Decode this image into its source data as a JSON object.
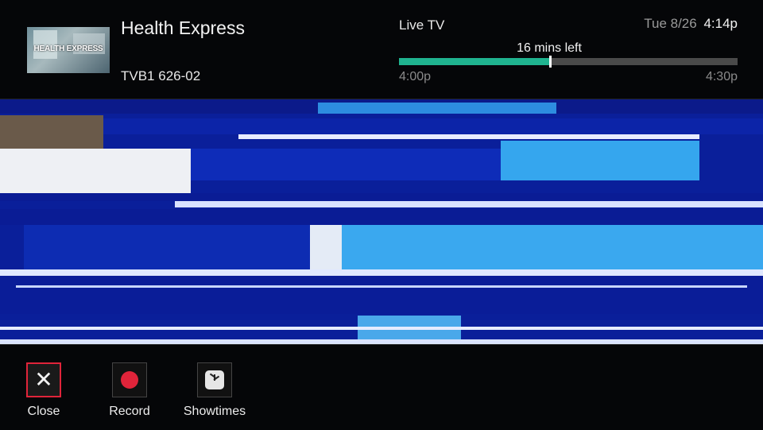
{
  "program": {
    "thumbnail_text": "HEALTH EXPRESS",
    "title": "Health Express",
    "channel": "TVB1 626-02"
  },
  "status": {
    "mode": "Live TV",
    "date": "Tue 8/26",
    "time": "4:14p",
    "remaining": "16 mins left",
    "start_time": "4:00p",
    "end_time": "4:30p",
    "progress_fraction": 0.445
  },
  "actions": [
    {
      "label": "Close",
      "icon": "close-icon",
      "focused": true
    },
    {
      "label": "Record",
      "icon": "record-icon",
      "focused": false
    },
    {
      "label": "Showtimes",
      "icon": "clock-icon",
      "focused": false
    }
  ],
  "colors": {
    "progress_fill": "#1fb38f",
    "focus_border": "#e0243a",
    "record_dot": "#e0243a"
  }
}
